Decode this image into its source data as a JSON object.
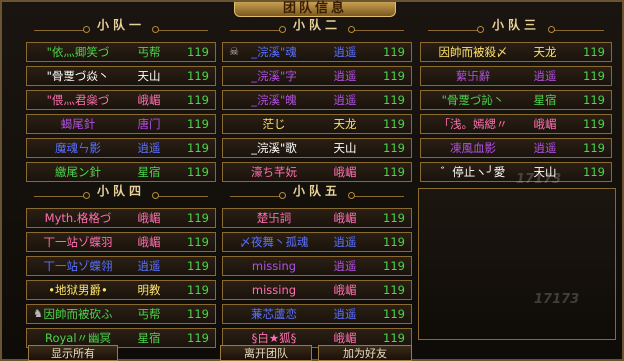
{
  "window": {
    "title": "团队信息"
  },
  "colors": {
    "green": "#4cd44c",
    "white": "#ffffff",
    "purple": "#b050e0",
    "blue": "#5a70ff",
    "yellow": "#ffe26a",
    "pink": "#ff70b0",
    "gold": "#e8d29a"
  },
  "teams": [
    {
      "name": "小队一",
      "members": [
        {
          "name": "\"依灬卿笑づ",
          "sect": "丐帮",
          "level": "119",
          "color": "#4cd44c"
        },
        {
          "name": "\"骨覂づ焱丶",
          "sect": "天山",
          "level": "119",
          "color": "#ffffff"
        },
        {
          "name": "\"偎灬君橤づ",
          "sect": "峨嵋",
          "level": "119",
          "color": "#ff70b0"
        },
        {
          "name": "蝎尾針",
          "sect": "唐门",
          "level": "119",
          "color": "#b050e0"
        },
        {
          "name": "魔魂ㄣ影",
          "sect": "逍遥",
          "level": "119",
          "color": "#5a70ff"
        },
        {
          "name": "繳尾ン針",
          "sect": "星宿",
          "level": "119",
          "color": "#4cd44c"
        }
      ]
    },
    {
      "name": "小队二",
      "members": [
        {
          "name": "_浣溪\"魂",
          "sect": "逍遥",
          "level": "119",
          "color": "#5a70ff",
          "icon": "mask"
        },
        {
          "name": "_浣溪\"字",
          "sect": "逍遥",
          "level": "119",
          "color": "#b050e0"
        },
        {
          "name": "_浣溪\"魄",
          "sect": "逍遥",
          "level": "119",
          "color": "#b050e0"
        },
        {
          "name": "茫じ",
          "sect": "天龙",
          "level": "119",
          "color": "#ffe26a"
        },
        {
          "name": "_浣溪\"歌",
          "sect": "天山",
          "level": "119",
          "color": "#ffffff"
        },
        {
          "name": "濠ち芊妧",
          "sect": "峨嵋",
          "level": "119",
          "color": "#ff70b0"
        }
      ]
    },
    {
      "name": "小队三",
      "members": [
        {
          "name": "因帥而被殺〆",
          "sect": "天龙",
          "level": "119",
          "color": "#ffe26a"
        },
        {
          "name": "蕠卐辭",
          "sect": "逍遥",
          "level": "119",
          "color": "#b050e0"
        },
        {
          "name": "\"骨覂づ訫丶",
          "sect": "星宿",
          "level": "119",
          "color": "#4cd44c"
        },
        {
          "name": "「浅。嫣緦〃",
          "sect": "峨嵋",
          "level": "119",
          "color": "#ff70b0"
        },
        {
          "name": "凍風血影",
          "sect": "逍遥",
          "level": "119",
          "color": "#b050e0"
        },
        {
          "name": "゛停止ヽ╯愛",
          "sect": "天山",
          "level": "119",
          "color": "#ffffff"
        }
      ]
    },
    {
      "name": "小队四",
      "members": [
        {
          "name": "Myth.格格づ",
          "sect": "峨嵋",
          "level": "119",
          "color": "#ff70b0"
        },
        {
          "name": "丅一站ゾ蝶羽",
          "sect": "峨嵋",
          "level": "119",
          "color": "#ff70b0"
        },
        {
          "name": "丅一站ゾ蝶翎",
          "sect": "逍遥",
          "level": "119",
          "color": "#5a70ff"
        },
        {
          "name": "•地狱男爵•",
          "sect": "明教",
          "level": "119",
          "color": "#ffe26a"
        },
        {
          "name": "因帥而被砍ふ",
          "sect": "丐帮",
          "level": "119",
          "color": "#4cd44c",
          "icon": "skull"
        },
        {
          "name": "Royal〃幽冥",
          "sect": "星宿",
          "level": "119",
          "color": "#4cd44c"
        }
      ]
    },
    {
      "name": "小队五",
      "members": [
        {
          "name": "楚卐詞",
          "sect": "峨嵋",
          "level": "119",
          "color": "#ff70b0"
        },
        {
          "name": "〆夜舞丶孤魂",
          "sect": "逍遥",
          "level": "119",
          "color": "#5a70ff"
        },
        {
          "name": "missing",
          "sect": "逍遥",
          "level": "119",
          "color": "#b050e0"
        },
        {
          "name": "missing",
          "sect": "峨嵋",
          "level": "119",
          "color": "#ff70b0"
        },
        {
          "name": "蒹芯蘆恋",
          "sect": "逍遥",
          "level": "119",
          "color": "#5a70ff"
        },
        {
          "name": "§白★狐§",
          "sect": "峨嵋",
          "level": "119",
          "color": "#ff70b0"
        }
      ]
    }
  ],
  "buttons": {
    "show_all": "显示所有",
    "leave_team": "离开团队",
    "add_friend": "加为好友"
  },
  "watermark": "17173"
}
